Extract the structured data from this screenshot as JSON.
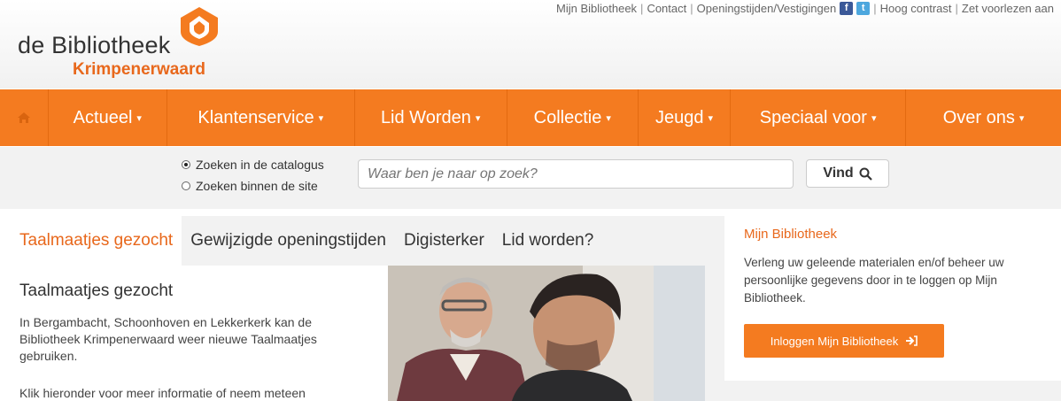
{
  "header": {
    "logo_line1": "de Bibliotheek",
    "logo_line2": "Krimpenerwaard",
    "links": [
      "Mijn Bibliotheek",
      "Contact",
      "Openingstijden/Vestigingen",
      "Hoog contrast",
      "Zet voorlezen aan"
    ],
    "social_icons": [
      "facebook-icon",
      "twitter-icon"
    ]
  },
  "nav": {
    "home_icon": "home-icon",
    "items": [
      {
        "label": "Actueel"
      },
      {
        "label": "Klantenservice"
      },
      {
        "label": "Lid Worden"
      },
      {
        "label": "Collectie"
      },
      {
        "label": "Jeugd"
      },
      {
        "label": "Speciaal voor"
      },
      {
        "label": "Over ons"
      }
    ],
    "caret_glyph": "▾"
  },
  "search": {
    "option_catalog": "Zoeken in de catalogus",
    "option_site": "Zoeken binnen de site",
    "selected": "catalog",
    "placeholder": "Waar ben je naar op zoek?",
    "button_label": "Vind"
  },
  "tabs": [
    {
      "label": "Taalmaatjes gezocht",
      "active": true
    },
    {
      "label": "Gewijzigde openingstijden",
      "active": false
    },
    {
      "label": "Digisterker",
      "active": false
    },
    {
      "label": "Lid worden?",
      "active": false
    }
  ],
  "article": {
    "title": "Taalmaatjes gezocht",
    "body": "In Bergambacht, Schoonhoven en Lekkerkerk kan de Bibliotheek Krimpenerwaard weer nieuwe Taalmaatjes gebruiken.",
    "more": "Klik hieronder voor meer informatie of neem meteen"
  },
  "sidebar": {
    "title": "Mijn Bibliotheek",
    "text": "Verleng uw geleende materialen en/of beheer uw persoonlijke gegevens door in te loggen op Mijn Bibliotheek.",
    "button_label": "Inloggen Mijn Bibliotheek"
  },
  "colors": {
    "brand_orange": "#f47b20",
    "link_orange": "#e8681c",
    "facebook": "#3b5998",
    "twitter": "#4da7de"
  }
}
